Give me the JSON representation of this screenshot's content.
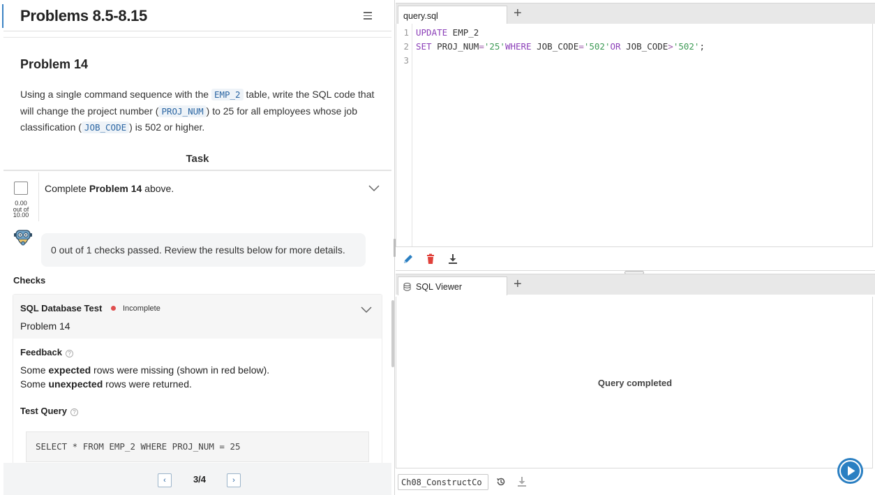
{
  "left_panel": {
    "title": "Problems 8.5-8.15",
    "problem": {
      "heading": "Problem 14",
      "text_part1": "Using a single command sequence with the ",
      "code1": "EMP_2",
      "text_part2": " table, write the SQL code that will change the project number (",
      "code2": "PROJ_NUM",
      "text_part3": ") to 25 for all employees whose job classification (",
      "code3": "JOB_CODE",
      "text_part4": ") is 502 or higher."
    },
    "task": {
      "section_label": "Task",
      "row_prefix": "Complete ",
      "row_bold": "Problem 14",
      "row_suffix": " above.",
      "score_line1": "0.00",
      "score_line2": "out of",
      "score_line3": "10.00"
    },
    "bot_message": "0 out of 1 checks passed. Review the results below for more details.",
    "checks": {
      "label": "Checks",
      "card": {
        "title": "SQL Database Test",
        "status": "Incomplete",
        "status_color": "#e04f4f",
        "subtitle": "Problem 14",
        "feedback_label": "Feedback",
        "feedback1_pre": "Some ",
        "feedback1_bold": "expected",
        "feedback1_post": " rows were missing (shown in red below).",
        "feedback2_pre": "Some ",
        "feedback2_bold": "unexpected",
        "feedback2_post": " rows were returned.",
        "test_query_label": "Test Query",
        "test_query": "SELECT * FROM EMP_2 WHERE PROJ_NUM = 25"
      }
    },
    "pager": {
      "prev": "‹",
      "count": "3/4",
      "next": "›"
    }
  },
  "editor": {
    "tab_label": "query.sql",
    "add_tab": "+",
    "line_numbers": [
      "1",
      "2",
      "3"
    ]
  },
  "viewer": {
    "tab_label": "SQL Viewer",
    "add_tab": "+",
    "message": "Query completed"
  },
  "bottom_bar": {
    "database": "Ch08_ConstructCo"
  },
  "icons": {
    "menu": "hamburger-menu-icon",
    "edit": "pencil-icon",
    "delete": "trash-icon",
    "download": "download-icon",
    "history": "history-icon",
    "run": "play-icon",
    "database": "database-icon"
  },
  "colors": {
    "accent": "#2a7fc2",
    "delete_red": "#e0403a",
    "keyword": "#8b3fb8",
    "string": "#3d9a55"
  }
}
